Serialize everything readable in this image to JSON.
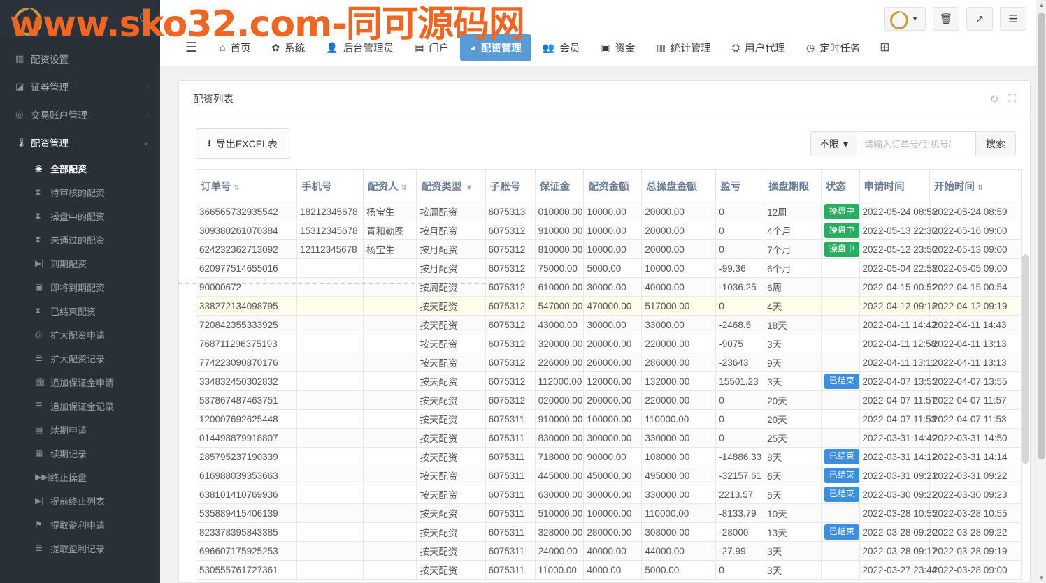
{
  "watermark": {
    "top_text": "www.sko32.com-同可源码网",
    "mid_text": "· · · · · · · · ·"
  },
  "sidebar": {
    "logo_name": "brand-logo",
    "items": [
      {
        "icon": "bar-chart-icon",
        "glyph": "▥",
        "label": "配资设置",
        "arrow": "",
        "active": false
      },
      {
        "icon": "area-chart-icon",
        "glyph": "◪",
        "label": "证券管理",
        "arrow": "‹",
        "active": false
      },
      {
        "icon": "user-circle-icon",
        "glyph": "◎",
        "label": "交易账户管理",
        "arrow": "‹",
        "active": false
      },
      {
        "icon": "thermometer-icon",
        "glyph": "🌡",
        "label": "配资管理",
        "arrow": "⌄",
        "active": true
      }
    ],
    "submenu": [
      {
        "icon": "lifebuoy-icon",
        "glyph": "◉",
        "label": "全部配资",
        "selected": true
      },
      {
        "icon": "hourglass-icon",
        "glyph": "⧗",
        "label": "待审核的配资",
        "selected": false
      },
      {
        "icon": "hourglass-icon",
        "glyph": "⧗",
        "label": "操盘中的配资",
        "selected": false
      },
      {
        "icon": "hourglass-icon",
        "glyph": "⧗",
        "label": "未通过的配资",
        "selected": false
      },
      {
        "icon": "step-forward-icon",
        "glyph": "▶|",
        "label": "到期配资",
        "selected": false
      },
      {
        "icon": "camera-icon",
        "glyph": "▣",
        "label": "即将到期配资",
        "selected": false
      },
      {
        "icon": "hourglass-icon",
        "glyph": "⧗",
        "label": "已结束配资",
        "selected": false
      },
      {
        "icon": "upload-icon",
        "glyph": "⎙",
        "label": "扩大配资申请",
        "selected": false
      },
      {
        "icon": "list-icon",
        "glyph": "☰",
        "label": "扩大配资记录",
        "selected": false
      },
      {
        "icon": "bank-icon",
        "glyph": "🏛",
        "label": "追加保证金申请",
        "selected": false
      },
      {
        "icon": "list-icon",
        "glyph": "☰",
        "label": "追加保证金记录",
        "selected": false
      },
      {
        "icon": "file-icon",
        "glyph": "▤",
        "label": "续期申请",
        "selected": false
      },
      {
        "icon": "list-alt-icon",
        "glyph": "▦",
        "label": "续期记录",
        "selected": false
      },
      {
        "icon": "fast-forward-icon",
        "glyph": "▶▶|",
        "label": "终止操盘",
        "selected": false
      },
      {
        "icon": "step-forward-icon",
        "glyph": "▶|",
        "label": "提前终止列表",
        "selected": false
      },
      {
        "icon": "flag-icon",
        "glyph": "⚑",
        "label": "提取盈利申请",
        "selected": false
      },
      {
        "icon": "list-icon",
        "glyph": "☰",
        "label": "提取盈利记录",
        "selected": false
      }
    ]
  },
  "topbar": {
    "hamburger_icon": "hamburger-icon",
    "nav": [
      {
        "icon": "home-icon",
        "glyph": "⌂",
        "label": "首页",
        "active": false
      },
      {
        "icon": "gear-icon",
        "glyph": "✿",
        "label": "系统",
        "active": false
      },
      {
        "icon": "user-icon",
        "glyph": "👤",
        "label": "后台管理员",
        "active": false
      },
      {
        "icon": "window-icon",
        "glyph": "▤",
        "label": "门户",
        "active": false
      },
      {
        "icon": "pie-chart-icon",
        "glyph": "◕",
        "label": "配资管理",
        "active": true
      },
      {
        "icon": "users-icon",
        "glyph": "👥",
        "label": "会员",
        "active": false
      },
      {
        "icon": "money-icon",
        "glyph": "▣",
        "label": "资金",
        "active": false
      },
      {
        "icon": "stats-icon",
        "glyph": "▥",
        "label": "统计管理",
        "active": false
      },
      {
        "icon": "sitemap-icon",
        "glyph": "⛭",
        "label": "用户代理",
        "active": false
      },
      {
        "icon": "clock-icon",
        "glyph": "◷",
        "label": "定时任务",
        "active": false
      }
    ],
    "grid_icon_label": "⊞",
    "actions": [
      {
        "name": "user-menu-button",
        "glyph": ""
      },
      {
        "name": "trash-button",
        "glyph": "🗑"
      },
      {
        "name": "external-link-button",
        "glyph": "↗"
      },
      {
        "name": "list-menu-button",
        "glyph": "☰"
      }
    ]
  },
  "panel": {
    "title": "配资列表",
    "refresh_icon": "↻",
    "fullscreen_icon": "⛶"
  },
  "toolbar": {
    "export_icon": "⭳",
    "export_label": "导出EXCEL表",
    "limit_label": "不限",
    "limit_caret": "▾",
    "search_placeholder": "请输入订单号/手机号/",
    "search_value": "",
    "search_button": "搜索"
  },
  "table": {
    "columns": [
      {
        "label": "订单号",
        "sort": "⇅",
        "filter": ""
      },
      {
        "label": "手机号",
        "sort": "",
        "filter": ""
      },
      {
        "label": "配资人",
        "sort": "⇅",
        "filter": ""
      },
      {
        "label": "配资类型",
        "sort": "",
        "filter": "▼"
      },
      {
        "label": "子账号",
        "sort": "",
        "filter": ""
      },
      {
        "label": "保证金",
        "sort": "",
        "filter": ""
      },
      {
        "label": "配资金额",
        "sort": "",
        "filter": ""
      },
      {
        "label": "总操盘金额",
        "sort": "",
        "filter": ""
      },
      {
        "label": "盈亏",
        "sort": "",
        "filter": ""
      },
      {
        "label": "操盘期限",
        "sort": "",
        "filter": ""
      },
      {
        "label": "状态",
        "sort": "",
        "filter": ""
      },
      {
        "label": "申请时间",
        "sort": "",
        "filter": ""
      },
      {
        "label": "开始时间",
        "sort": "⇅",
        "filter": ""
      }
    ],
    "rows": [
      {
        "order": "366565732935542",
        "phone": "18212345678",
        "person": "杨宝生",
        "type": "按周配资",
        "subacct": "6075313",
        "deposit": "010000.00",
        "amount": "10000.00",
        "total": "20000.00",
        "pnl": "0",
        "term": "12周",
        "status": "操盘中",
        "status_color": "green",
        "apply_time": "2022-05-24 08:58",
        "start_time": "2022-05-24 08:59",
        "highlight": false
      },
      {
        "order": "309380261070384",
        "phone": "15312345678",
        "person": "青和勒图",
        "type": "按月配资",
        "subacct": "6075312",
        "deposit": "910000.00",
        "amount": "10000.00",
        "total": "20000.00",
        "pnl": "0",
        "term": "4个月",
        "status": "操盘中",
        "status_color": "green",
        "apply_time": "2022-05-13 22:30",
        "start_time": "2022-05-16 09:00",
        "highlight": false
      },
      {
        "order": "624232362713092",
        "phone": "12112345678",
        "person": "杨宝生",
        "type": "按月配资",
        "subacct": "6075312",
        "deposit": "810000.00",
        "amount": "10000.00",
        "total": "20000.00",
        "pnl": "0",
        "term": "7个月",
        "status": "操盘中",
        "status_color": "green",
        "apply_time": "2022-05-12 23:50",
        "start_time": "2022-05-13 09:00",
        "highlight": false
      },
      {
        "order": "620977514655016",
        "phone": "",
        "person": "",
        "type": "按月配资",
        "subacct": "6075312",
        "deposit": "75000.00",
        "amount": "5000.00",
        "total": "10000.00",
        "pnl": "-99.36",
        "term": "6个月",
        "status": "",
        "status_color": "",
        "apply_time": "2022-05-04 22:58",
        "start_time": "2022-05-05 09:00",
        "highlight": false
      },
      {
        "order": "90000672",
        "phone": "",
        "person": "",
        "type": "按周配资",
        "subacct": "6075312",
        "deposit": "610000.00",
        "amount": "30000.00",
        "total": "40000.00",
        "pnl": "-1036.25",
        "term": "6周",
        "status": "",
        "status_color": "",
        "apply_time": "2022-04-15 00:52",
        "start_time": "2022-04-15 00:54",
        "highlight": false
      },
      {
        "order": "338272134098795",
        "phone": "",
        "person": "",
        "type": "按天配资",
        "subacct": "6075312",
        "deposit": "547000.00",
        "amount": "470000.00",
        "total": "517000.00",
        "pnl": "0",
        "term": "4天",
        "status": "",
        "status_color": "",
        "apply_time": "2022-04-12 09:18",
        "start_time": "2022-04-12 09:19",
        "highlight": true
      },
      {
        "order": "720842355333925",
        "phone": "",
        "person": "",
        "type": "按天配资",
        "subacct": "6075312",
        "deposit": "43000.00",
        "amount": "30000.00",
        "total": "33000.00",
        "pnl": "-2468.5",
        "term": "18天",
        "status": "",
        "status_color": "",
        "apply_time": "2022-04-11 14:42",
        "start_time": "2022-04-11 14:43",
        "highlight": false
      },
      {
        "order": "768711296375193",
        "phone": "",
        "person": "",
        "type": "按天配资",
        "subacct": "6075312",
        "deposit": "320000.00",
        "amount": "200000.00",
        "total": "220000.00",
        "pnl": "-9075",
        "term": "3天",
        "status": "",
        "status_color": "",
        "apply_time": "2022-04-11 12:58",
        "start_time": "2022-04-11 13:13",
        "highlight": false
      },
      {
        "order": "774223090870176",
        "phone": "",
        "person": "",
        "type": "按天配资",
        "subacct": "6075312",
        "deposit": "226000.00",
        "amount": "260000.00",
        "total": "286000.00",
        "pnl": "-23643",
        "term": "9天",
        "status": "",
        "status_color": "",
        "apply_time": "2022-04-11 13:11",
        "start_time": "2022-04-11 13:13",
        "highlight": false
      },
      {
        "order": "334832450302832",
        "phone": "",
        "person": "",
        "type": "按天配资",
        "subacct": "6075312",
        "deposit": "112000.00",
        "amount": "120000.00",
        "total": "132000.00",
        "pnl": "15501.23",
        "term": "3天",
        "status": "已结束",
        "status_color": "blue",
        "apply_time": "2022-04-07 13:55",
        "start_time": "2022-04-07 13:55",
        "highlight": false
      },
      {
        "order": "537867487463751",
        "phone": "",
        "person": "",
        "type": "按天配资",
        "subacct": "6075312",
        "deposit": "020000.00",
        "amount": "200000.00",
        "total": "220000.00",
        "pnl": "0",
        "term": "20天",
        "status": "",
        "status_color": "",
        "apply_time": "2022-04-07 11:57",
        "start_time": "2022-04-07 11:57",
        "highlight": false
      },
      {
        "order": "120007692625448",
        "phone": "",
        "person": "",
        "type": "按天配资",
        "subacct": "6075311",
        "deposit": "910000.00",
        "amount": "100000.00",
        "total": "110000.00",
        "pnl": "0",
        "term": "20天",
        "status": "",
        "status_color": "",
        "apply_time": "2022-04-07 11:53",
        "start_time": "2022-04-07 11:53",
        "highlight": false
      },
      {
        "order": "014498879918807",
        "phone": "",
        "person": "",
        "type": "按天配资",
        "subacct": "6075311",
        "deposit": "830000.00",
        "amount": "300000.00",
        "total": "330000.00",
        "pnl": "0",
        "term": "25天",
        "status": "",
        "status_color": "",
        "apply_time": "2022-03-31 14:49",
        "start_time": "2022-03-31 14:50",
        "highlight": false
      },
      {
        "order": "285795237190339",
        "phone": "",
        "person": "",
        "type": "按天配资",
        "subacct": "6075311",
        "deposit": "718000.00",
        "amount": "90000.00",
        "total": "108000.00",
        "pnl": "-14886.33",
        "term": "8天",
        "status": "已结束",
        "status_color": "blue",
        "apply_time": "2022-03-31 14:12",
        "start_time": "2022-03-31 14:14",
        "highlight": false
      },
      {
        "order": "616988039353663",
        "phone": "",
        "person": "",
        "type": "按天配资",
        "subacct": "6075311",
        "deposit": "445000.00",
        "amount": "450000.00",
        "total": "495000.00",
        "pnl": "-32157.61",
        "term": "6天",
        "status": "已结束",
        "status_color": "blue",
        "apply_time": "2022-03-31 09:21",
        "start_time": "2022-03-31 09:22",
        "highlight": false
      },
      {
        "order": "638101410769936",
        "phone": "",
        "person": "",
        "type": "按天配资",
        "subacct": "6075311",
        "deposit": "630000.00",
        "amount": "300000.00",
        "total": "330000.00",
        "pnl": "2213.57",
        "term": "5天",
        "status": "已结束",
        "status_color": "blue",
        "apply_time": "2022-03-30 09:22",
        "start_time": "2022-03-30 09:23",
        "highlight": false
      },
      {
        "order": "535889415406139",
        "phone": "",
        "person": "",
        "type": "按天配资",
        "subacct": "6075311",
        "deposit": "510000.00",
        "amount": "100000.00",
        "total": "110000.00",
        "pnl": "-8133.79",
        "term": "10天",
        "status": "",
        "status_color": "",
        "apply_time": "2022-03-28 10:55",
        "start_time": "2022-03-28 10:55",
        "highlight": false
      },
      {
        "order": "823378395843385",
        "phone": "",
        "person": "",
        "type": "按天配资",
        "subacct": "6075311",
        "deposit": "328000.00",
        "amount": "280000.00",
        "total": "308000.00",
        "pnl": "-28000",
        "term": "13天",
        "status": "已结束",
        "status_color": "blue",
        "apply_time": "2022-03-28 09:20",
        "start_time": "2022-03-28 09:22",
        "highlight": false
      },
      {
        "order": "696607175925253",
        "phone": "",
        "person": "",
        "type": "按天配资",
        "subacct": "6075311",
        "deposit": "24000.00",
        "amount": "40000.00",
        "total": "44000.00",
        "pnl": "-27.99",
        "term": "3天",
        "status": "",
        "status_color": "",
        "apply_time": "2022-03-28 09:17",
        "start_time": "2022-03-28 09:19",
        "highlight": false
      },
      {
        "order": "530555761727361",
        "phone": "",
        "person": "",
        "type": "按天配资",
        "subacct": "6075311",
        "deposit": "11000.00",
        "amount": "4000.00",
        "total": "5000.00",
        "pnl": "0",
        "term": "3天",
        "status": "",
        "status_color": "",
        "apply_time": "2022-03-27 23:44",
        "start_time": "2022-03-28 09:00",
        "highlight": false
      }
    ]
  },
  "scrollbar": {
    "up_arrow": "▲",
    "down_arrow": "▼"
  }
}
